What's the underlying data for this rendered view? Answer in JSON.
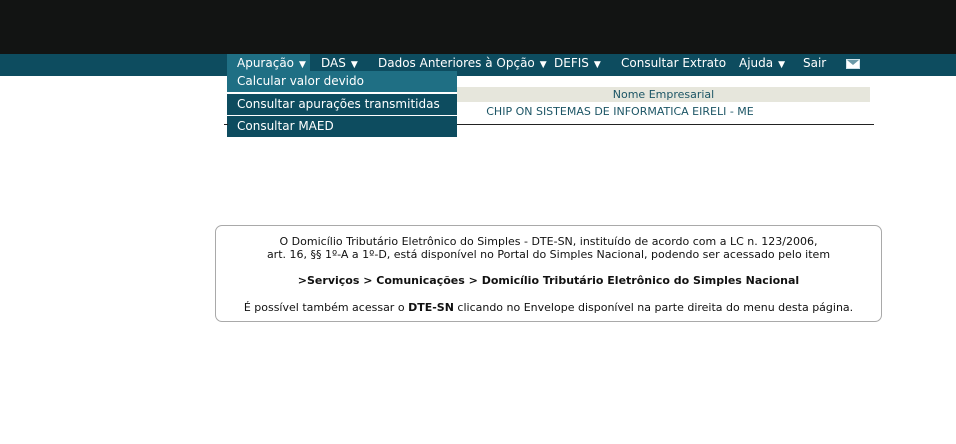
{
  "nav": {
    "items": [
      {
        "label": "Apuração",
        "caret": "▼"
      },
      {
        "label": "DAS",
        "caret": "▼"
      },
      {
        "label": "Dados Anteriores à Opção",
        "caret": "▼"
      },
      {
        "label": "DEFIS",
        "caret": "▼"
      },
      {
        "label": "Consultar Extrato"
      },
      {
        "label": "Ajuda",
        "caret": "▼"
      },
      {
        "label": "Sair"
      }
    ],
    "envelope_icon": "envelope-icon"
  },
  "dropdown": {
    "items": [
      {
        "label": "Calcular valor devido"
      },
      {
        "label": "Consultar apurações transmitidas"
      },
      {
        "label": "Consultar MAED"
      }
    ]
  },
  "company": {
    "header": "Nome Empresarial",
    "name": "CHIP ON SISTEMAS DE INFORMATICA EIRELI - ME"
  },
  "notice": {
    "line1": "O Domicílio Tributário Eletrônico do Simples - DTE-SN, instituído de acordo com a LC n. 123/2006,",
    "line2": "art. 16, §§ 1º-A a 1º-D, está disponível no Portal do Simples Nacional, podendo ser acessado pelo item",
    "path": ">Serviços > Comunicações > Domicílio Tributário Eletrônico do Simples Nacional",
    "p2_before": "É possível também acessar o ",
    "p2_bold": "DTE-SN",
    "p2_after": " clicando no Envelope disponível na parte direita do menu desta página."
  },
  "colors": {
    "top_bar": "#121413",
    "nav_bar": "#0d4c5f",
    "nav_active": "#1f6f84",
    "header_bg": "#e6e6dc",
    "text_teal": "#1c5565"
  }
}
